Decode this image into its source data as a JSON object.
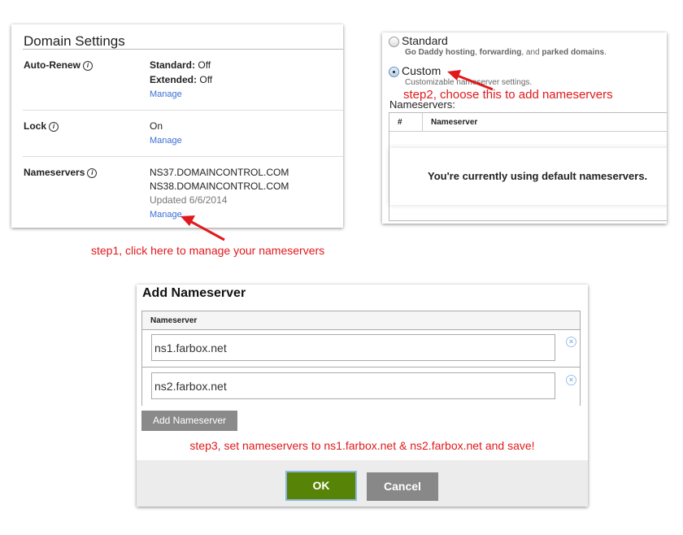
{
  "domain_settings": {
    "title": "Domain Settings",
    "auto_renew": {
      "label": "Auto-Renew",
      "standard_label": "Standard:",
      "standard_value": "Off",
      "extended_label": "Extended:",
      "extended_value": "Off",
      "manage": "Manage"
    },
    "lock": {
      "label": "Lock",
      "value": "On",
      "manage": "Manage"
    },
    "nameservers": {
      "label": "Nameservers",
      "ns": [
        "NS37.DOMAINCONTROL.COM",
        "NS38.DOMAINCONTROL.COM"
      ],
      "updated": "Updated 6/6/2014",
      "manage": "Manage"
    },
    "info_glyph": "i"
  },
  "ns_type": {
    "standard_label": "Standard",
    "standard_desc": {
      "a": "Go Daddy hosting",
      "b": ", ",
      "c": "forwarding",
      ",d": "",
      "d": ", and ",
      "e": "parked domains",
      "f": "."
    },
    "custom_label": "Custom",
    "custom_desc": "Customizable nameserver settings.",
    "nameservers_label": "Nameservers:",
    "col_num": "#",
    "col_ns": "Nameserver",
    "empty_msg": "You're currently using default nameservers."
  },
  "dialog": {
    "title": "Add Nameserver",
    "col": "Nameserver",
    "inputs": [
      "ns1.farbox.net",
      "ns2.farbox.net"
    ],
    "remove_glyph": "×",
    "add_button": "Add Nameserver",
    "ok": "OK",
    "cancel": "Cancel"
  },
  "annotations": {
    "step1": "step1, click here to manage your nameservers",
    "step2": "step2, choose this to add nameservers",
    "step3": "step3, set nameservers to ns1.farbox.net & ns2.farbox.net and save!"
  },
  "colors": {
    "annotation": "#e0191c",
    "link": "#3b6fd6",
    "ok": "#578406",
    "cancel": "#888888"
  }
}
